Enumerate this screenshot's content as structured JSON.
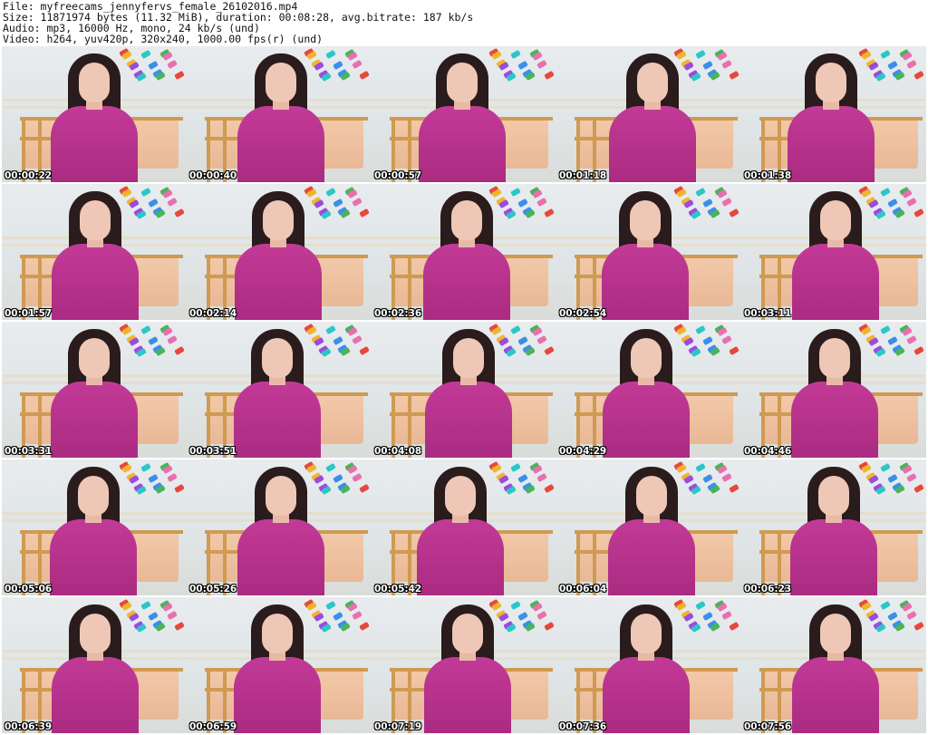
{
  "header": {
    "file_line": "File: myfreecams_jennyfervs_female_26102016.mp4",
    "size_line": "Size: 11871974 bytes (11.32 MiB), duration: 00:08:28, avg.bitrate: 187 kb/s",
    "audio_line": "Audio: mp3, 16000 Hz, mono, 24 kb/s (und)",
    "video_line": "Video: h264, yuv420p, 320x240, 1000.00 fps(r) (und)"
  },
  "thumbnails": [
    "00:00:22",
    "00:00:40",
    "00:00:57",
    "00:01:18",
    "00:01:38",
    "00:01:57",
    "00:02:14",
    "00:02:36",
    "00:02:54",
    "00:03:11",
    "00:03:31",
    "00:03:51",
    "00:04:08",
    "00:04:29",
    "00:04:46",
    "00:05:06",
    "00:05:26",
    "00:05:42",
    "00:06:04",
    "00:06:23",
    "00:06:39",
    "00:06:59",
    "00:07:19",
    "00:07:36",
    "00:07:56"
  ],
  "colors": {
    "background": "#ffffff",
    "dress": "#c23a97",
    "hair": "#2a1c1c",
    "bed": "#f2c9a9"
  }
}
